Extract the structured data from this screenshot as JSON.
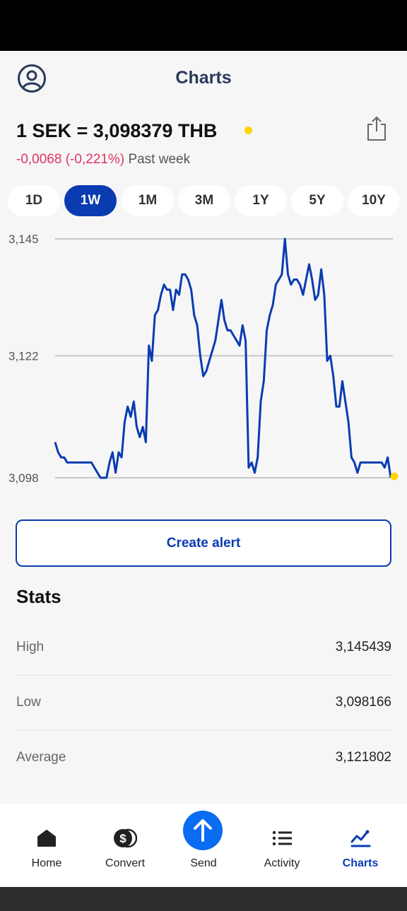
{
  "header": {
    "title": "Charts"
  },
  "rate": {
    "text": "1 SEK = 3,098379 THB",
    "indicator_color": "#ffd500"
  },
  "change": {
    "delta": "-0,0068 (-0,221%)",
    "period": "Past week"
  },
  "periods": [
    "1D",
    "1W",
    "1M",
    "3M",
    "1Y",
    "5Y",
    "10Y"
  ],
  "selected_period": "1W",
  "chart_data": {
    "type": "line",
    "title": "",
    "xlabel": "",
    "ylabel": "",
    "ylim": [
      3.098,
      3.145
    ],
    "yticks": [
      "3,145",
      "3,122",
      "3,098"
    ],
    "tick_values": [
      3.145,
      3.122,
      3.098
    ],
    "grid": true,
    "line_color": "#0a3bb1",
    "endpoint_color": "#ffd500",
    "series": [
      {
        "values": [
          3.105,
          3.103,
          3.102,
          3.102,
          3.101,
          3.101,
          3.101,
          3.101,
          3.101,
          3.101,
          3.101,
          3.101,
          3.101,
          3.1,
          3.099,
          3.098,
          3.098,
          3.098,
          3.101,
          3.103,
          3.099,
          3.103,
          3.102,
          3.109,
          3.112,
          3.11,
          3.113,
          3.108,
          3.106,
          3.108,
          3.105,
          3.124,
          3.121,
          3.13,
          3.131,
          3.134,
          3.136,
          3.135,
          3.135,
          3.131,
          3.135,
          3.134,
          3.138,
          3.138,
          3.137,
          3.135,
          3.13,
          3.128,
          3.122,
          3.118,
          3.119,
          3.121,
          3.123,
          3.125,
          3.129,
          3.133,
          3.129,
          3.127,
          3.127,
          3.126,
          3.125,
          3.124,
          3.128,
          3.125,
          3.1,
          3.101,
          3.099,
          3.102,
          3.113,
          3.117,
          3.127,
          3.13,
          3.132,
          3.136,
          3.137,
          3.138,
          3.145,
          3.138,
          3.136,
          3.137,
          3.137,
          3.136,
          3.134,
          3.137,
          3.14,
          3.137,
          3.133,
          3.134,
          3.139,
          3.134,
          3.121,
          3.122,
          3.118,
          3.112,
          3.112,
          3.117,
          3.113,
          3.109,
          3.102,
          3.101,
          3.099,
          3.101,
          3.101,
          3.101,
          3.101,
          3.101,
          3.101,
          3.101,
          3.101,
          3.1,
          3.102,
          3.098
        ]
      }
    ]
  },
  "create_alert_label": "Create alert",
  "stats": {
    "title": "Stats",
    "rows": [
      {
        "label": "High",
        "value": "3,145439"
      },
      {
        "label": "Low",
        "value": "3,098166"
      },
      {
        "label": "Average",
        "value": "3,121802"
      }
    ]
  },
  "nav": {
    "items": [
      {
        "label": "Home",
        "icon": "home-icon"
      },
      {
        "label": "Convert",
        "icon": "dollar-coins-icon"
      },
      {
        "label": "Send",
        "icon": "arrow-up-icon"
      },
      {
        "label": "Activity",
        "icon": "list-icon"
      },
      {
        "label": "Charts",
        "icon": "chart-line-icon"
      }
    ],
    "active": "Charts",
    "accent_color": "#0a3bb1"
  }
}
